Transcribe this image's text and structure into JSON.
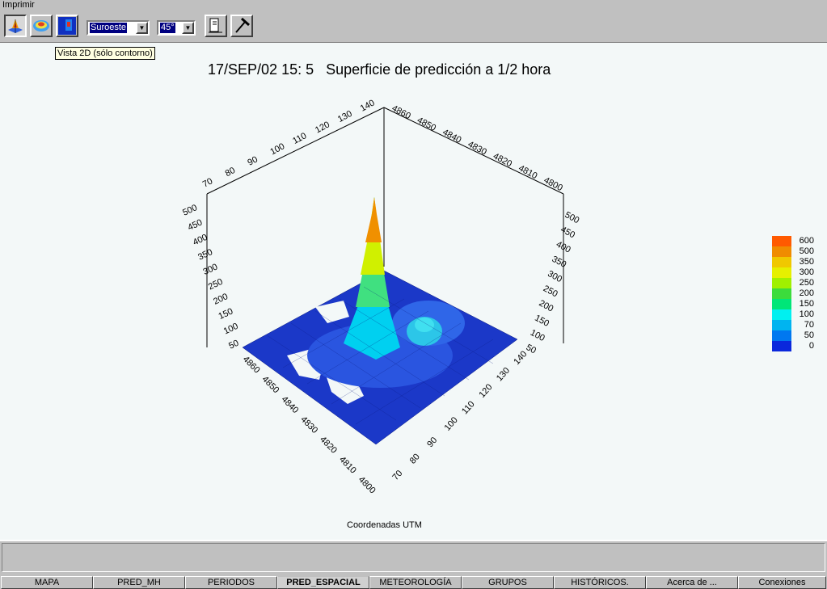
{
  "menu": {
    "print": "Imprimir"
  },
  "toolbar": {
    "buttons": [
      {
        "name": "view-3d-surface-button",
        "icon": "surface-3d-icon"
      },
      {
        "name": "view-3d-contour-button",
        "icon": "contour-3d-icon"
      },
      {
        "name": "view-2d-contour-button",
        "icon": "contour-2d-icon"
      }
    ],
    "direction_value": "Suroeste",
    "angle_value": "45°",
    "tooltip": "Vista 2D (sólo contorno)"
  },
  "plot": {
    "title": "17/SEP/02 15: 5   Superficie de predicción a 1/2 hora",
    "xlabel": "Coordenadas UTM",
    "top_left_axis": [
      "70",
      "80",
      "90",
      "100",
      "110",
      "120",
      "130",
      "140"
    ],
    "top_right_axis": [
      "4860",
      "4850",
      "4840",
      "4830",
      "4820",
      "4810",
      "4800"
    ],
    "left_z_axis": [
      "500",
      "450",
      "400",
      "350",
      "300",
      "250",
      "200",
      "150",
      "100",
      "50"
    ],
    "right_z_axis": [
      "500",
      "450",
      "400",
      "350",
      "300",
      "250",
      "200",
      "150",
      "100",
      "50"
    ],
    "bottom_left_axis": [
      "4860",
      "4850",
      "4840",
      "4830",
      "4820",
      "4810",
      "4800"
    ],
    "bottom_right_axis": [
      "70",
      "80",
      "90",
      "100",
      "110",
      "120",
      "130",
      "140"
    ]
  },
  "legend": [
    {
      "label": "600",
      "color": "#ff5a00"
    },
    {
      "label": "500",
      "color": "#f08c00"
    },
    {
      "label": "350",
      "color": "#f0c800"
    },
    {
      "label": "300",
      "color": "#e6f000"
    },
    {
      "label": "250",
      "color": "#a0f000"
    },
    {
      "label": "200",
      "color": "#3cdc3c"
    },
    {
      "label": "150",
      "color": "#00e678"
    },
    {
      "label": "100",
      "color": "#00f0f0"
    },
    {
      "label": "70",
      "color": "#00b4f0"
    },
    {
      "label": "50",
      "color": "#0078f0"
    },
    {
      "label": "0",
      "color": "#0a28dc"
    }
  ],
  "tabs": [
    "MAPA",
    "PRED_MH",
    "PERIODOS",
    "PRED_ESPACIAL",
    "METEOROLOGÍA",
    "GRUPOS",
    "HISTÓRICOS.",
    "Acerca de ...",
    "Conexiones"
  ],
  "active_tab": "PRED_ESPACIAL"
}
